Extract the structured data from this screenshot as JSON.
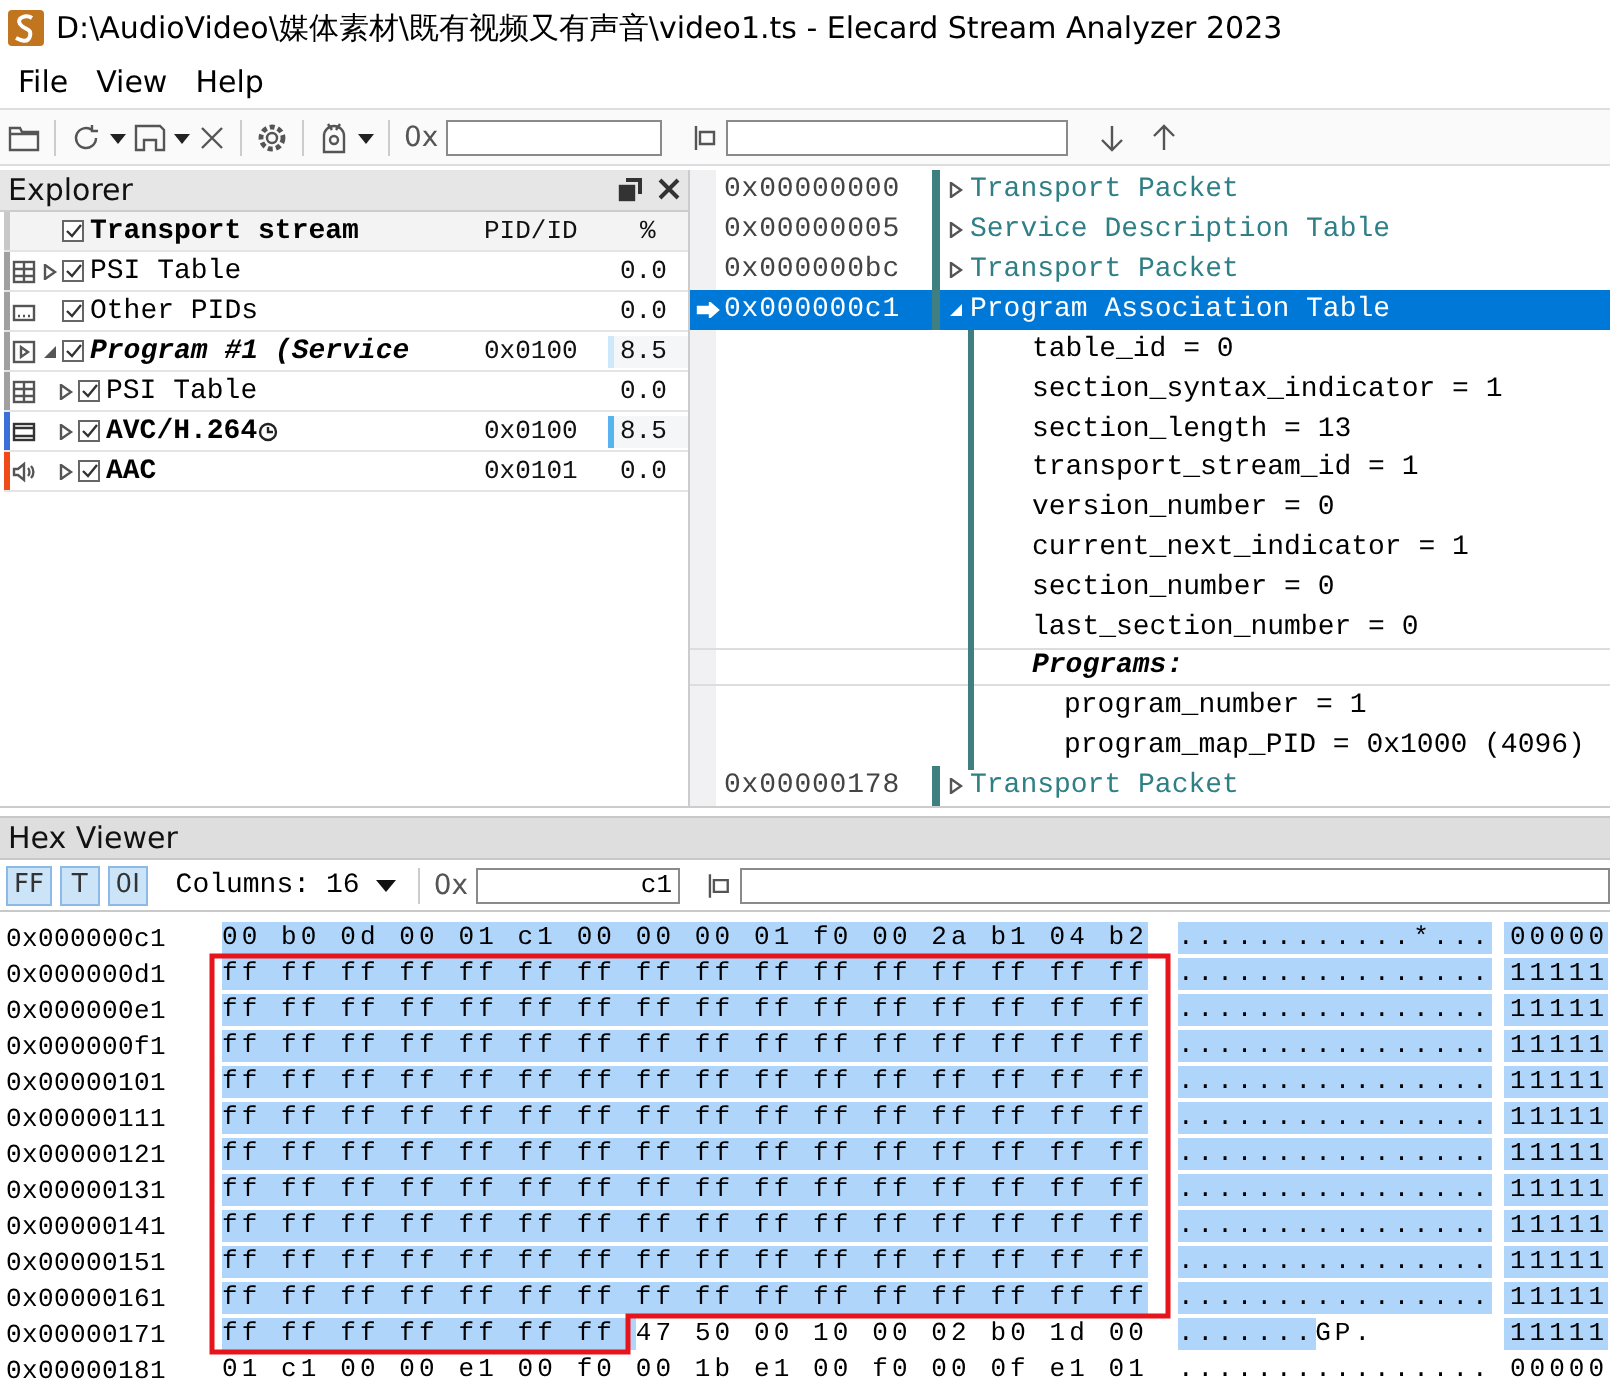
{
  "window": {
    "title": "D:\\AudioVideo\\媒体素材\\既有视频又有声音\\video1.ts - Elecard Stream Analyzer 2023"
  },
  "menu": [
    "File",
    "View",
    "Help"
  ],
  "toolbar": {
    "offset_label": "0x"
  },
  "explorer": {
    "title": "Explorer",
    "root": {
      "label": "Transport stream",
      "checked": true
    },
    "columns": [
      "PID/ID",
      "%"
    ],
    "items": [
      {
        "kind": "table",
        "label": "PSI Table",
        "checked": true,
        "expanded": false,
        "percent": "0.0",
        "color": "#a0a0a0"
      },
      {
        "kind": "other",
        "label": "Other PIDs",
        "checked": true,
        "percent": "0.0",
        "color": "#a0a0a0"
      },
      {
        "kind": "program",
        "label": "Program #1 (Service",
        "checked": true,
        "expanded": true,
        "pid": "0x0100",
        "percent": "8.5",
        "level": 0.085,
        "color": "#a0a0a0",
        "children": [
          {
            "kind": "table",
            "label": "PSI Table",
            "checked": true,
            "expanded": false,
            "percent": "0.0",
            "color": "#a0a0a0"
          },
          {
            "kind": "video",
            "label": "AVC/H.264",
            "checked": true,
            "expanded": false,
            "pid": "0x0100",
            "percent": "8.5",
            "level": 0.085,
            "color": "#3a6fd8"
          },
          {
            "kind": "audio",
            "label": "AAC",
            "checked": true,
            "expanded": false,
            "pid": "0x0101",
            "percent": "0.0",
            "color": "#f04a1a"
          }
        ]
      }
    ]
  },
  "packets": [
    {
      "offset": "0x00000000",
      "label": "Transport Packet",
      "expanded": false,
      "selected": false
    },
    {
      "offset": "0x00000005",
      "label": "Service Description Table",
      "expanded": false,
      "selected": false
    },
    {
      "offset": "0x000000bc",
      "label": "Transport Packet",
      "expanded": false,
      "selected": false
    },
    {
      "offset": "0x000000c1",
      "label": "Program Association Table",
      "expanded": true,
      "selected": true,
      "fields": [
        {
          "kind": "field",
          "text": "table_id = 0"
        },
        {
          "kind": "field",
          "text": "section_syntax_indicator = 1"
        },
        {
          "kind": "field",
          "text": "section_length = 13"
        },
        {
          "kind": "field",
          "text": "transport_stream_id = 1"
        },
        {
          "kind": "field",
          "text": "version_number = 0"
        },
        {
          "kind": "field",
          "text": "current_next_indicator = 1"
        },
        {
          "kind": "field",
          "text": "section_number = 0"
        },
        {
          "kind": "field",
          "text": "last_section_number = 0"
        },
        {
          "kind": "heading",
          "text": "Programs:",
          "children": [
            {
              "kind": "field",
              "text": "program_number = 1"
            },
            {
              "kind": "field",
              "text": "program_map_PID = 0x1000 (4096)"
            }
          ]
        }
      ]
    },
    {
      "offset": "0x00000178",
      "label": "Transport Packet",
      "expanded": false,
      "selected": false
    }
  ],
  "hex_viewer": {
    "title": "Hex Viewer",
    "modes": [
      {
        "label": "FF",
        "selected": true
      },
      {
        "label": "T",
        "selected": true
      },
      {
        "label": "0I",
        "selected": true
      }
    ],
    "columns_label": "Columns:",
    "columns_value": "16",
    "offset_label": "0x",
    "offset_value": "c1",
    "rows": [
      {
        "offset": "0x000000c1",
        "hex": [
          {
            "text": "00 b0 0d 00 01 c1 00 00 00 01 f0 00 2a b1 04 b2",
            "selected": true
          }
        ],
        "ascii": [
          {
            "text": "............*...",
            "selected": true
          }
        ],
        "bits": {
          "text": "00000",
          "selected": true
        }
      },
      {
        "offset": "0x000000d1",
        "hex": [
          {
            "text": "ff ff ff ff ff ff ff ff ff ff ff ff ff ff ff ff",
            "selected": true
          }
        ],
        "ascii": [
          {
            "text": "................",
            "selected": true
          }
        ],
        "bits": {
          "text": "11111",
          "selected": true
        }
      },
      {
        "offset": "0x000000e1",
        "hex": [
          {
            "text": "ff ff ff ff ff ff ff ff ff ff ff ff ff ff ff ff",
            "selected": true
          }
        ],
        "ascii": [
          {
            "text": "................",
            "selected": true
          }
        ],
        "bits": {
          "text": "11111",
          "selected": true
        }
      },
      {
        "offset": "0x000000f1",
        "hex": [
          {
            "text": "ff ff ff ff ff ff ff ff ff ff ff ff ff ff ff ff",
            "selected": true
          }
        ],
        "ascii": [
          {
            "text": "................",
            "selected": true
          }
        ],
        "bits": {
          "text": "11111",
          "selected": true
        }
      },
      {
        "offset": "0x00000101",
        "hex": [
          {
            "text": "ff ff ff ff ff ff ff ff ff ff ff ff ff ff ff ff",
            "selected": true
          }
        ],
        "ascii": [
          {
            "text": "................",
            "selected": true
          }
        ],
        "bits": {
          "text": "11111",
          "selected": true
        }
      },
      {
        "offset": "0x00000111",
        "hex": [
          {
            "text": "ff ff ff ff ff ff ff ff ff ff ff ff ff ff ff ff",
            "selected": true
          }
        ],
        "ascii": [
          {
            "text": "................",
            "selected": true
          }
        ],
        "bits": {
          "text": "11111",
          "selected": true
        }
      },
      {
        "offset": "0x00000121",
        "hex": [
          {
            "text": "ff ff ff ff ff ff ff ff ff ff ff ff ff ff ff ff",
            "selected": true
          }
        ],
        "ascii": [
          {
            "text": "................",
            "selected": true
          }
        ],
        "bits": {
          "text": "11111",
          "selected": true
        }
      },
      {
        "offset": "0x00000131",
        "hex": [
          {
            "text": "ff ff ff ff ff ff ff ff ff ff ff ff ff ff ff ff",
            "selected": true
          }
        ],
        "ascii": [
          {
            "text": "................",
            "selected": true
          }
        ],
        "bits": {
          "text": "11111",
          "selected": true
        }
      },
      {
        "offset": "0x00000141",
        "hex": [
          {
            "text": "ff ff ff ff ff ff ff ff ff ff ff ff ff ff ff ff",
            "selected": true
          }
        ],
        "ascii": [
          {
            "text": "................",
            "selected": true
          }
        ],
        "bits": {
          "text": "11111",
          "selected": true
        }
      },
      {
        "offset": "0x00000151",
        "hex": [
          {
            "text": "ff ff ff ff ff ff ff ff ff ff ff ff ff ff ff ff",
            "selected": true
          }
        ],
        "ascii": [
          {
            "text": "................",
            "selected": true
          }
        ],
        "bits": {
          "text": "11111",
          "selected": true
        }
      },
      {
        "offset": "0x00000161",
        "hex": [
          {
            "text": "ff ff ff ff ff ff ff ff ff ff ff ff ff ff ff ff",
            "selected": true
          }
        ],
        "ascii": [
          {
            "text": "................",
            "selected": true
          }
        ],
        "bits": {
          "text": "11111",
          "selected": true
        }
      },
      {
        "offset": "0x00000171",
        "hex": [
          {
            "text": "ff ff ff ff ff ff ff",
            "selected": true
          },
          {
            "text": "47 50 00 10 00 02 b0 1d 00",
            "selected": false
          }
        ],
        "ascii": [
          {
            "text": ".......",
            "selected": true
          },
          {
            "text": "GP.",
            "selected": false
          }
        ],
        "bits": {
          "text": "11111",
          "selected": true
        }
      },
      {
        "offset": "0x00000181",
        "hex": [
          {
            "text": "01 c1 00 00 e1 00 f0 00 1b e1 00 f0 00 0f e1 01",
            "selected": false
          }
        ],
        "ascii": [
          {
            "text": "................",
            "selected": false
          }
        ],
        "bits": {
          "text": "00000",
          "selected": false
        }
      }
    ]
  }
}
